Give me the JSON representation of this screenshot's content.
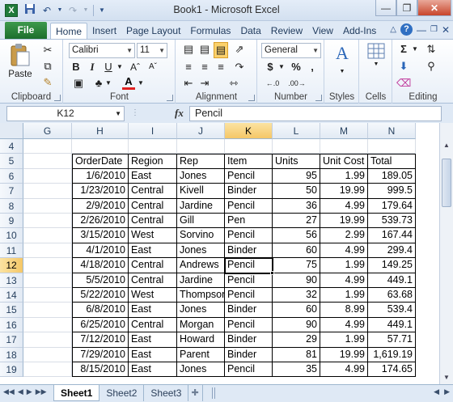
{
  "titlebar": {
    "title": "Book1  -  Microsoft Excel",
    "app_icon": "X",
    "qat": {
      "save_icon": "save-icon",
      "undo_icon": "undo-icon",
      "redo_icon": "redo-icon"
    }
  },
  "tabs": {
    "file": "File",
    "items": [
      "Home",
      "Insert",
      "Page Layout",
      "Formulas",
      "Data",
      "Review",
      "View",
      "Add-Ins"
    ],
    "active": "Home"
  },
  "ribbon": {
    "clipboard": {
      "label": "Clipboard",
      "paste": "Paste"
    },
    "font": {
      "label": "Font",
      "name": "Calibri",
      "size": "11",
      "bold": "B",
      "italic": "I",
      "underline": "U"
    },
    "alignment": {
      "label": "Alignment"
    },
    "number": {
      "label": "Number",
      "format": "General",
      "currency": "$",
      "percent": "%",
      "comma": ","
    },
    "styles": {
      "label": "Styles"
    },
    "cells": {
      "label": "Cells"
    },
    "editing": {
      "label": "Editing"
    }
  },
  "formula_bar": {
    "name_box": "K12",
    "fx": "fx",
    "content": "Pencil"
  },
  "grid": {
    "columns": [
      "G",
      "H",
      "I",
      "J",
      "K",
      "L",
      "M",
      "N"
    ],
    "selected_column": "K",
    "selected_row": "12",
    "rows": [
      "4",
      "5",
      "6",
      "7",
      "8",
      "9",
      "10",
      "11",
      "12",
      "13",
      "14",
      "15",
      "16",
      "17",
      "18",
      "19"
    ],
    "headers": [
      "OrderDate",
      "Region",
      "Rep",
      "Item",
      "Units",
      "Unit Cost",
      "Total"
    ],
    "data": [
      [
        "1/6/2010",
        "East",
        "Jones",
        "Pencil",
        "95",
        "1.99",
        "189.05"
      ],
      [
        "1/23/2010",
        "Central",
        "Kivell",
        "Binder",
        "50",
        "19.99",
        "999.5"
      ],
      [
        "2/9/2010",
        "Central",
        "Jardine",
        "Pencil",
        "36",
        "4.99",
        "179.64"
      ],
      [
        "2/26/2010",
        "Central",
        "Gill",
        "Pen",
        "27",
        "19.99",
        "539.73"
      ],
      [
        "3/15/2010",
        "West",
        "Sorvino",
        "Pencil",
        "56",
        "2.99",
        "167.44"
      ],
      [
        "4/1/2010",
        "East",
        "Jones",
        "Binder",
        "60",
        "4.99",
        "299.4"
      ],
      [
        "4/18/2010",
        "Central",
        "Andrews",
        "Pencil",
        "75",
        "1.99",
        "149.25"
      ],
      [
        "5/5/2010",
        "Central",
        "Jardine",
        "Pencil",
        "90",
        "4.99",
        "449.1"
      ],
      [
        "5/22/2010",
        "West",
        "Thompson",
        "Pencil",
        "32",
        "1.99",
        "63.68"
      ],
      [
        "6/8/2010",
        "East",
        "Jones",
        "Binder",
        "60",
        "8.99",
        "539.4"
      ],
      [
        "6/25/2010",
        "Central",
        "Morgan",
        "Pencil",
        "90",
        "4.99",
        "449.1"
      ],
      [
        "7/12/2010",
        "East",
        "Howard",
        "Binder",
        "29",
        "1.99",
        "57.71"
      ],
      [
        "7/29/2010",
        "East",
        "Parent",
        "Binder",
        "81",
        "19.99",
        "1,619.19"
      ],
      [
        "8/15/2010",
        "East",
        "Jones",
        "Pencil",
        "35",
        "4.99",
        "174.65"
      ]
    ]
  },
  "sheets": {
    "items": [
      "Sheet1",
      "Sheet2",
      "Sheet3"
    ],
    "active": "Sheet1"
  }
}
